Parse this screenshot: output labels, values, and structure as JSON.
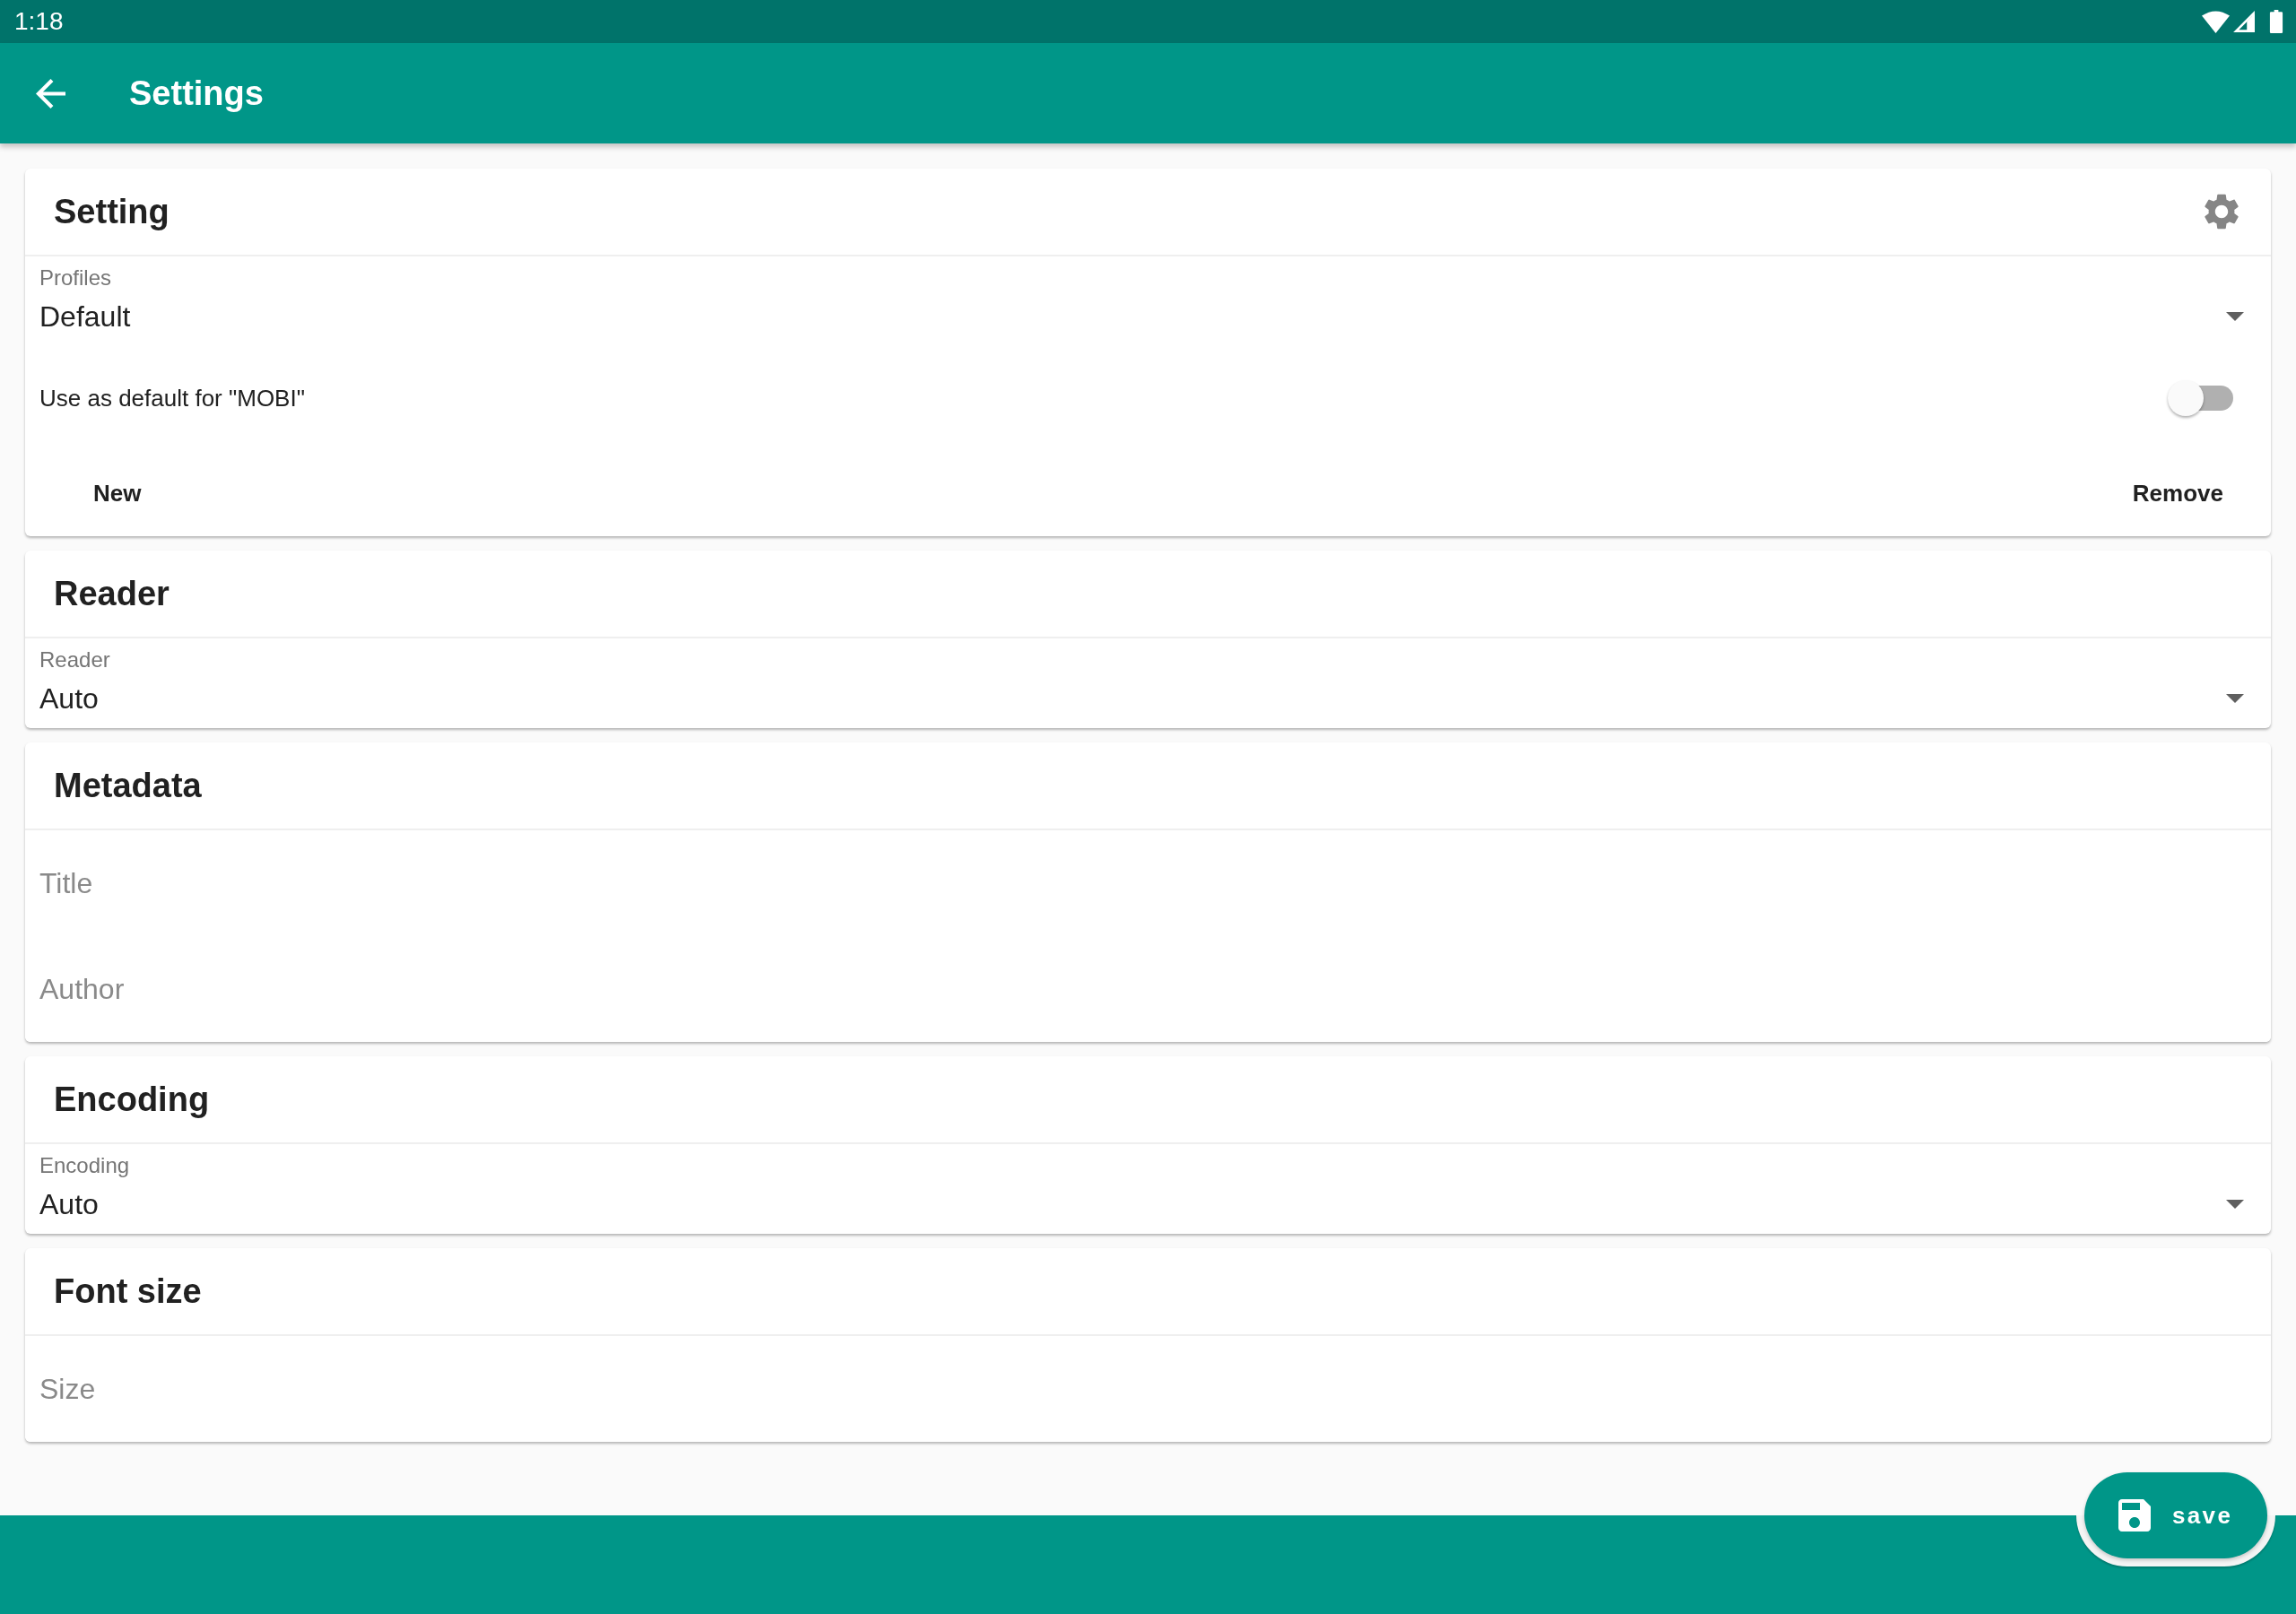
{
  "status_bar": {
    "time": "1:18"
  },
  "app_bar": {
    "title": "Settings"
  },
  "cards": [
    {
      "title": "Setting",
      "settings_button": true,
      "items": [
        {
          "kind": "dropdown",
          "label": "Profiles",
          "value": "Default"
        },
        {
          "kind": "toggle",
          "label": "Use as default for \"MOBI\"",
          "on": false
        },
        {
          "kind": "buttons",
          "buttons": [
            "New",
            "Remove"
          ]
        }
      ]
    },
    {
      "title": "Reader",
      "settings_button": false,
      "items": [
        {
          "kind": "dropdown",
          "label": "Reader",
          "value": "Auto"
        }
      ]
    },
    {
      "title": "Metadata",
      "settings_button": false,
      "items": [
        {
          "kind": "text_field",
          "placeholder": "Title"
        },
        {
          "kind": "text_field",
          "placeholder": "Author"
        }
      ]
    },
    {
      "title": "Encoding",
      "settings_button": false,
      "items": [
        {
          "kind": "dropdown",
          "label": "Encoding",
          "value": "Auto"
        }
      ]
    },
    {
      "title": "Font size",
      "settings_button": false,
      "items": [
        {
          "kind": "text_field",
          "placeholder": "Size"
        }
      ]
    }
  ],
  "fab": {
    "label": "save"
  }
}
